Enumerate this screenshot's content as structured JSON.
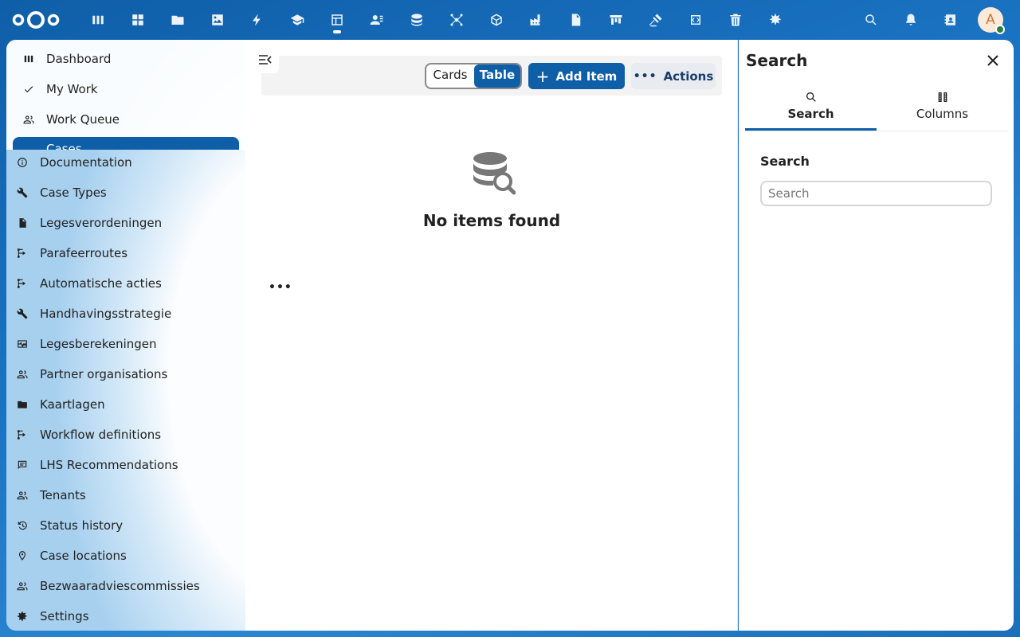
{
  "topbar": {
    "logo": "nextcloud-logo",
    "apps": [
      {
        "icon": "dashboard-icon"
      },
      {
        "icon": "grid-icon"
      },
      {
        "icon": "folder-icon"
      },
      {
        "icon": "image-icon"
      },
      {
        "icon": "lightning-icon"
      },
      {
        "icon": "graduation-cap-icon"
      },
      {
        "icon": "table-app-icon",
        "active": true
      },
      {
        "icon": "contacts-icon"
      },
      {
        "icon": "database-icon"
      },
      {
        "icon": "network-icon"
      },
      {
        "icon": "cube-icon"
      },
      {
        "icon": "factory-icon"
      },
      {
        "icon": "document-icon"
      },
      {
        "icon": "board-icon"
      },
      {
        "icon": "gavel-icon"
      },
      {
        "icon": "code-icon"
      },
      {
        "icon": "trash-icon"
      },
      {
        "icon": "leaf-icon"
      }
    ],
    "right": [
      "search-icon",
      "bell-icon",
      "contacts-book-icon"
    ],
    "avatar_letter": "A"
  },
  "nav": {
    "top_items": [
      {
        "label": "Dashboard",
        "icon": "dashboard-icon"
      },
      {
        "label": "My Work",
        "icon": "check-icon"
      },
      {
        "label": "Work Queue",
        "icon": "people-icon"
      }
    ],
    "active_item": "Cases",
    "items": [
      {
        "label": "Documentation",
        "icon": "info-icon"
      },
      {
        "label": "Case Types",
        "icon": "wrench-icon"
      },
      {
        "label": "Legesverordeningen",
        "icon": "file-icon"
      },
      {
        "label": "Parafeerroutes",
        "icon": "route-icon"
      },
      {
        "label": "Automatische acties",
        "icon": "route-icon"
      },
      {
        "label": "Handhavingsstrategie",
        "icon": "wrench-icon"
      },
      {
        "label": "Legesberekeningen",
        "icon": "pulse-icon"
      },
      {
        "label": "Partner organisations",
        "icon": "people-icon"
      },
      {
        "label": "Kaartlagen",
        "icon": "folder-icon"
      },
      {
        "label": "Workflow definitions",
        "icon": "route-icon"
      },
      {
        "label": "LHS Recommendations",
        "icon": "comment-icon"
      },
      {
        "label": "Tenants",
        "icon": "people-icon"
      },
      {
        "label": "Status history",
        "icon": "history-icon"
      },
      {
        "label": "Case locations",
        "icon": "pin-icon"
      },
      {
        "label": "Bezwaaradviescommissies",
        "icon": "people-icon"
      },
      {
        "label": "Settings",
        "icon": "gear-icon"
      }
    ]
  },
  "main": {
    "view_toggle": {
      "cards": "Cards",
      "table": "Table",
      "selected": "Table"
    },
    "add_label": "Add Item",
    "actions_label": "Actions",
    "empty_text": "No items found"
  },
  "sidebar": {
    "title": "Search",
    "tabs": [
      {
        "label": "Search",
        "icon": "search-icon",
        "active": true
      },
      {
        "label": "Columns",
        "icon": "columns-icon",
        "active": false
      }
    ],
    "section_label": "Search",
    "search_placeholder": "Search",
    "search_value": ""
  },
  "colors": {
    "primary": "#0f5ea8",
    "background": "#1a73c2"
  }
}
